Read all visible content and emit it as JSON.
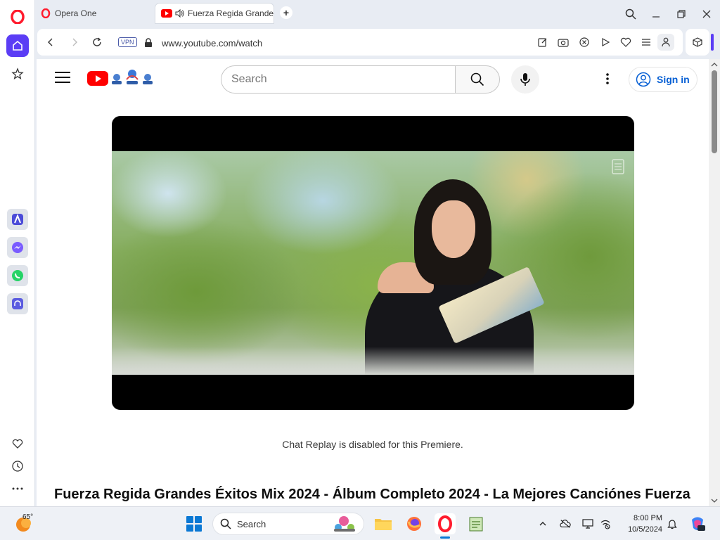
{
  "browser": {
    "tabs": [
      {
        "label": "Opera One",
        "icon": "opera-icon"
      },
      {
        "label": "Fuerza Regida Grande",
        "icon": "youtube-icon",
        "audio": true
      }
    ],
    "new_tab_label": "+",
    "vpn_label": "VPN",
    "url": "www.youtube.com/watch"
  },
  "youtube": {
    "search_placeholder": "Search",
    "signin_label": "Sign in",
    "chat_note": "Chat Replay is disabled for this Premiere.",
    "video_title": "Fuerza Regida Grandes Éxitos Mix 2024 - Álbum Completo 2024 - La Mejores Canciónes Fuerza"
  },
  "taskbar": {
    "temperature": "65°",
    "search_label": "Search",
    "time": "8:00 PM",
    "date": "10/5/2024"
  },
  "colors": {
    "opera_red": "#ff1b2d",
    "opera_accent": "#5b3df5",
    "youtube_red": "#ff0000",
    "link_blue": "#065fd4",
    "windows_blue": "#0a78d4"
  }
}
